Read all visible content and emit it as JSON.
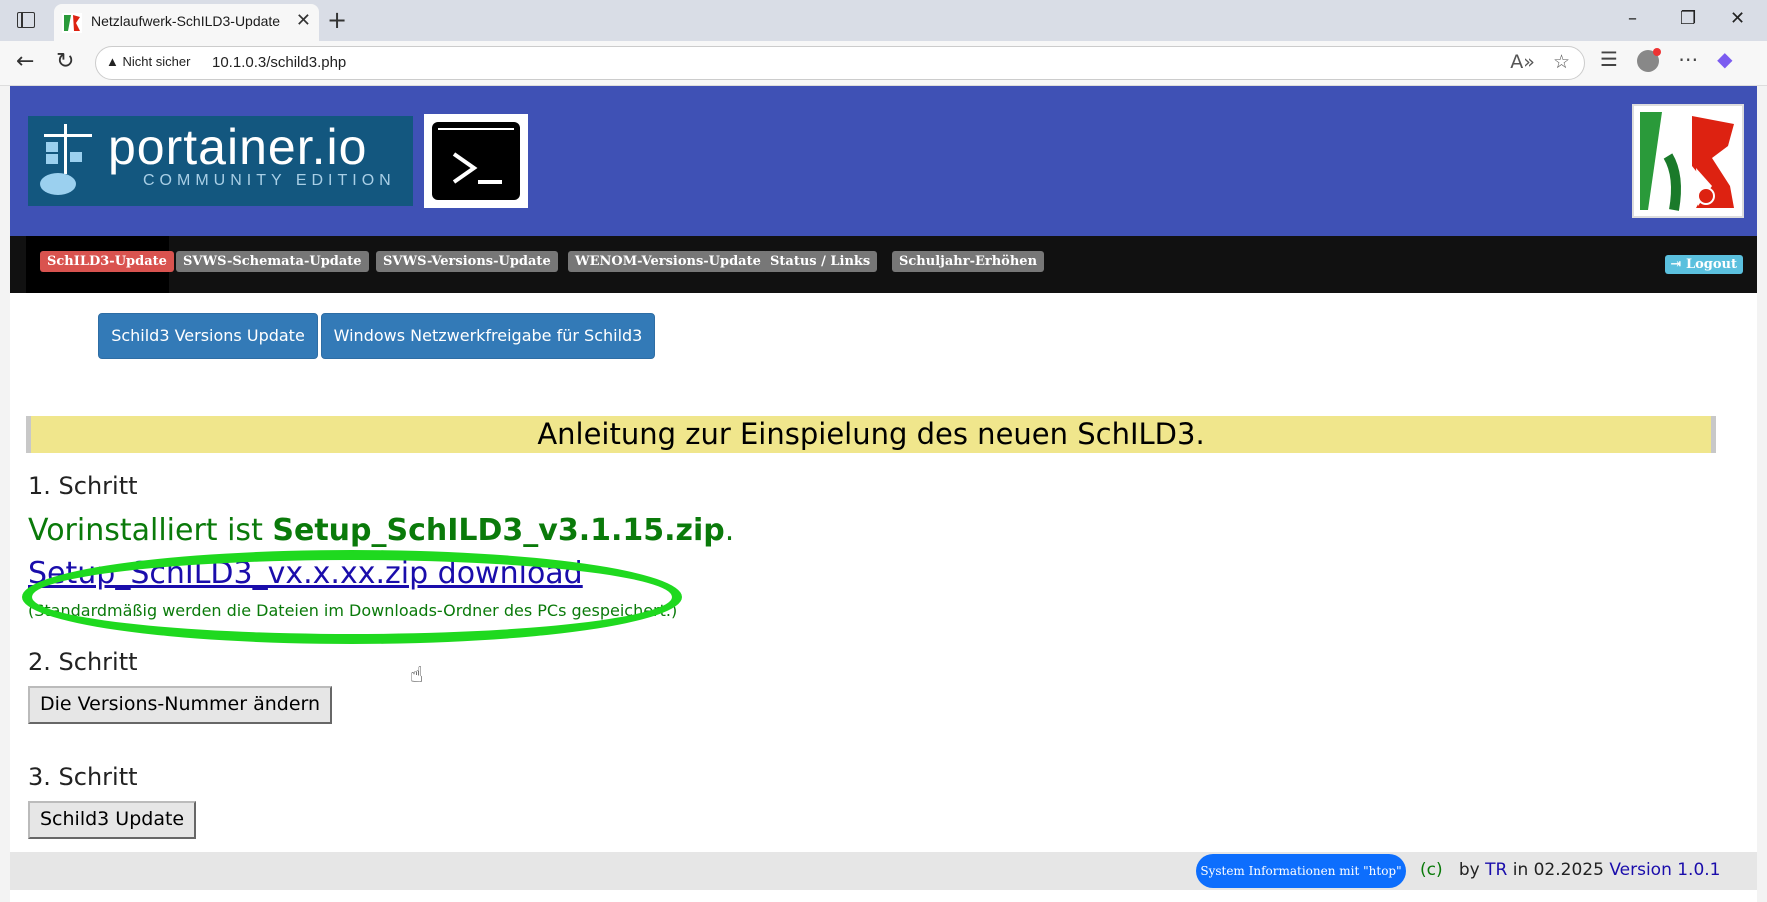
{
  "browser": {
    "tab_title": "Netzlaufwerk-SchILD3-Update",
    "not_secure": "Nicht sicher",
    "url": "10.1.0.3/schild3.php"
  },
  "header": {
    "portainer_name": "portainer.io",
    "portainer_edition": "COMMUNITY EDITION"
  },
  "nav": {
    "items": [
      {
        "label": "SchILD3-Update"
      },
      {
        "label": "SVWS-Schemata-Update"
      },
      {
        "label": "SVWS-Versions-Update"
      },
      {
        "label": "WENOM-Versions-Update"
      },
      {
        "label": "Status / Links"
      },
      {
        "label": "Schuljahr-Erhöhen"
      }
    ],
    "logout": "Logout"
  },
  "subnav": {
    "btn1": "Schild3 Versions Update",
    "btn2": "Windows Netzwerkfreigabe für Schild3"
  },
  "main": {
    "banner": "Anleitung zur Einspielung des neuen SchILD3.",
    "step1": "1. Schritt",
    "preinstalled_prefix": "Vorinstalliert ist ",
    "preinstalled_file": "Setup_SchILD3_v3.1.15.zip",
    "preinstalled_suffix": ".",
    "download_link": "Setup_SchILD3_vx.x.xx.zip download",
    "download_note": "(Standardmäßig werden die Dateien im Downloads-Ordner des PCs gespeichert.)",
    "step2": "2. Schritt",
    "step2_button": "Die Versions-Nummer ändern",
    "step3": "3. Schritt",
    "step3_button": "Schild3 Update"
  },
  "footer": {
    "htop_button": "System Informationen mit \"htop\"",
    "copyright": "(c)",
    "by": "by",
    "author": "TR",
    "in_date": "in 02.2025",
    "version": "Version 1.0.1"
  },
  "colors": {
    "header_bg": "#3f51b5",
    "highlight_ellipse": "#1fd91f",
    "active_nav": "#d9534f"
  }
}
